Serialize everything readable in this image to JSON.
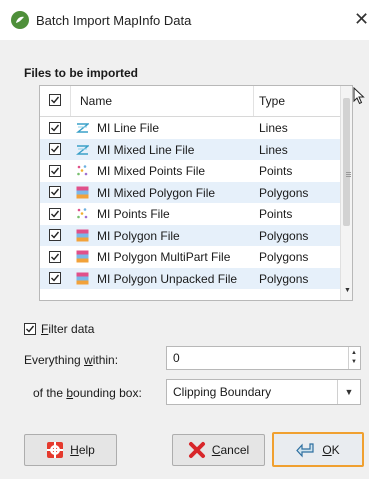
{
  "window": {
    "title": "Batch Import MapInfo Data",
    "close_glyph": "✕"
  },
  "files_section": {
    "title": "Files to be imported",
    "columns": {
      "name": "Name",
      "type": "Type"
    },
    "rows": [
      {
        "name": "MI Line File",
        "type": "Lines",
        "icon": "lines-icon",
        "checked": true
      },
      {
        "name": "MI Mixed Line File",
        "type": "Lines",
        "icon": "lines-icon",
        "checked": true
      },
      {
        "name": "MI Mixed Points File",
        "type": "Points",
        "icon": "points-icon",
        "checked": true
      },
      {
        "name": "MI Mixed Polygon File",
        "type": "Polygons",
        "icon": "polygons-icon",
        "checked": true
      },
      {
        "name": "MI Points File",
        "type": "Points",
        "icon": "points-icon",
        "checked": true
      },
      {
        "name": "MI Polygon File",
        "type": "Polygons",
        "icon": "polygons-icon",
        "checked": true
      },
      {
        "name": "MI Polygon MultiPart File",
        "type": "Polygons",
        "icon": "polygons-icon",
        "checked": true
      },
      {
        "name": "MI Polygon Unpacked File",
        "type": "Polygons",
        "icon": "polygons-icon",
        "checked": true
      }
    ]
  },
  "filter": {
    "checked": true,
    "label_underlined": "F",
    "label_rest": "ilter data",
    "within_pre": "Everything ",
    "within_ul": "w",
    "within_post": "ithin:",
    "within_value": "0",
    "bbox_pre": "of the ",
    "bbox_ul": "b",
    "bbox_post": "ounding box:",
    "bbox_value": "Clipping Boundary"
  },
  "buttons": {
    "help_ul": "H",
    "help_rest": "elp",
    "cancel_ul": "C",
    "cancel_rest": "ancel",
    "ok_ul": "O",
    "ok_rest": "K"
  },
  "colors": {
    "row_alt": "#e6f0fa",
    "ok_border": "#f0a030",
    "app_icon": "#4e8f3a"
  }
}
